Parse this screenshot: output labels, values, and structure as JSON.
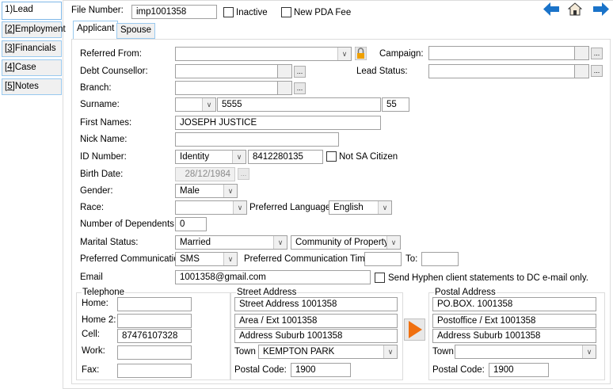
{
  "nav": [
    {
      "prefix": "1)",
      "label": "Lead"
    },
    {
      "prefix": "2",
      "label": "Employment"
    },
    {
      "prefix": "3",
      "label": "Financials"
    },
    {
      "prefix": "4",
      "label": "Case"
    },
    {
      "prefix": "5",
      "label": "Notes"
    }
  ],
  "header": {
    "file_number_label": "File Number:",
    "file_number": "imp1001358",
    "inactive_label": "Inactive",
    "new_pda_fee_label": "New PDA Fee"
  },
  "tabs": {
    "applicant": "Applicant",
    "spouse": "Spouse"
  },
  "form": {
    "referred_from_label": "Referred From:",
    "campaign_label": "Campaign:",
    "debt_counsellor_label": "Debt Counsellor:",
    "lead_status_label": "Lead Status:",
    "branch_label": "Branch:",
    "surname_label": "Surname:",
    "surname": "5555",
    "surname_suffix": "55",
    "first_names_label": "First Names:",
    "first_names": "JOSEPH JUSTICE",
    "nick_name_label": "Nick Name:",
    "id_number_label": "ID Number:",
    "id_type": "Identity",
    "id_number": "8412280135",
    "not_sa_citizen_label": "Not SA Citizen",
    "birth_date_label": "Birth Date:",
    "birth_date": "28/12/1984",
    "gender_label": "Gender:",
    "gender": "Male",
    "race_label": "Race:",
    "preferred_language_label": "Preferred Language:",
    "preferred_language": "English",
    "dependents_label": "Number of Dependents",
    "dependents": "0",
    "marital_status_label": "Marital Status:",
    "marital_status": "Married",
    "marital_regime": "Community of Property",
    "pref_comm_label": "Preferred Communication:",
    "pref_comm": "SMS",
    "pref_comm_time_label": "Preferred Communication Time:",
    "to_label": "To:",
    "email_label": "Email",
    "email": "1001358@gmail.com",
    "send_hyphen_label": "Send Hyphen client statements to DC e-mail only.",
    "dots": "..."
  },
  "telephone": {
    "title": "Telephone",
    "home_label": "Home:",
    "home2_label": "Home 2:",
    "cell_label": "Cell:",
    "cell": "87476107328",
    "work_label": "Work:",
    "fax_label": "Fax:"
  },
  "street": {
    "title": "Street Address",
    "line1": "Street Address 1001358",
    "line2": "Area / Ext 1001358",
    "line3": "Address Suburb 1001358",
    "town_label": "Town",
    "town": "KEMPTON PARK",
    "postal_code_label": "Postal Code:",
    "postal_code": "1900"
  },
  "postal": {
    "title": "Postal Address",
    "line1": "PO.BOX. 1001358",
    "line2": "Postoffice / Ext 1001358",
    "line3": "Address Suburb 1001358",
    "town_label": "Town",
    "town": "",
    "postal_code_label": "Postal Code:",
    "postal_code": "1900"
  }
}
